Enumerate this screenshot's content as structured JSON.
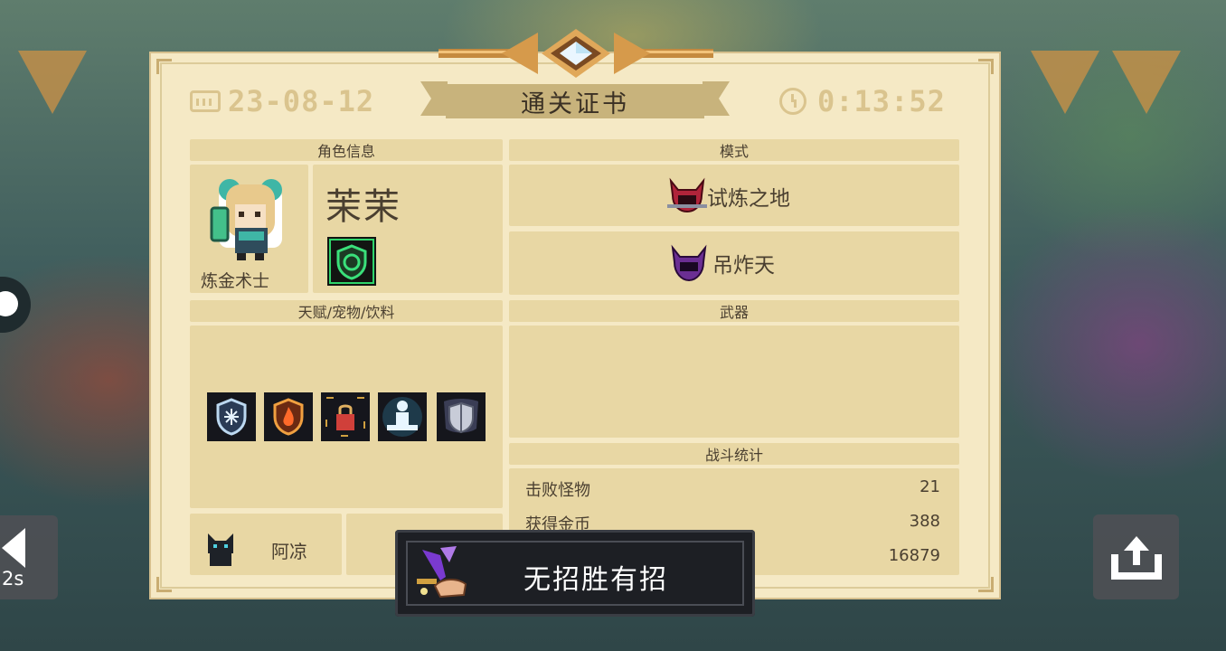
{
  "certificate": {
    "date": "23-08-12",
    "title": "通关证书",
    "time": "0:13:52"
  },
  "character": {
    "section_title": "角色信息",
    "name": "茉茉",
    "class": "炼金术士",
    "skill_icon": "green-shield-icon"
  },
  "mode": {
    "section_title": "模式",
    "items": [
      {
        "label": "试炼之地",
        "icon": "red-demon-helmet-icon"
      },
      {
        "label": "吊炸天",
        "icon": "purple-demon-helmet-icon"
      }
    ]
  },
  "talents": {
    "section_title": "天赋/宠物/饮料",
    "icons": [
      "ice-shield-icon",
      "fire-shield-icon",
      "lock-box-icon",
      "meditating-figure-icon",
      "armor-shield-icon"
    ]
  },
  "weapons": {
    "section_title": "武器"
  },
  "pet": {
    "name": "阿凉",
    "icon": "black-cat-icon"
  },
  "battle_stats": {
    "section_title": "战斗统计",
    "rows": [
      {
        "label": "击败怪物",
        "value": "21"
      },
      {
        "label": "获得金币",
        "value": "388"
      },
      {
        "label": "",
        "value": "16879"
      }
    ]
  },
  "achievement": {
    "title": "无招胜有招",
    "icon": "sword-on-hand-icon"
  },
  "controls": {
    "back_count": "2s"
  },
  "colors": {
    "parchment": "#f5e9c5",
    "section": "#e8d7a4",
    "ink": "#4a3f30",
    "gold": "#dac48e",
    "toast_bg": "#1d1f24"
  }
}
